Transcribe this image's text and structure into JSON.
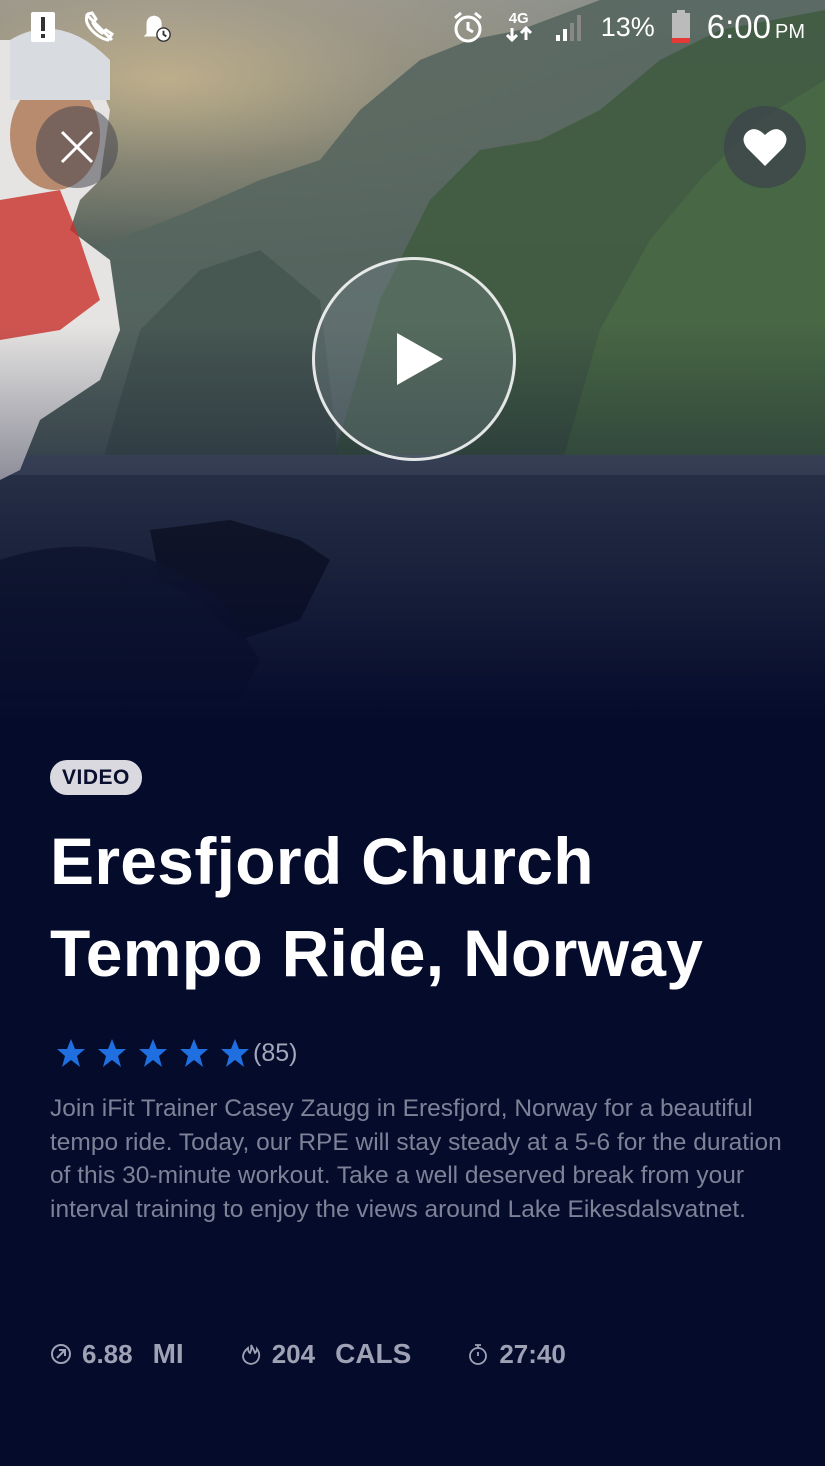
{
  "status_bar": {
    "battery_percent": "13%",
    "time": "6:00",
    "ampm": "PM",
    "network": "4G"
  },
  "video": {
    "badge": "VIDEO",
    "title_line1": "Eresfjord Church",
    "title_line2": "Tempo Ride, Norway",
    "rating_stars": 5,
    "rating_count": "(85)",
    "description": "Join iFit Trainer Casey Zaugg in Eresfjord, Norway for a beautiful tempo ride. Today, our RPE will stay steady at a 5-6 for the duration of this 30-minute workout. Take a well deserved break from your interval training to enjoy the views around Lake Eikesdalsvatnet."
  },
  "stats": {
    "distance_value": "6.88",
    "distance_unit": "MI",
    "calories_value": "204",
    "calories_unit": "CALS",
    "duration": "27:40"
  },
  "colors": {
    "background": "#050b2b",
    "star": "#1f6fe0",
    "battery_low": "#e53935"
  }
}
